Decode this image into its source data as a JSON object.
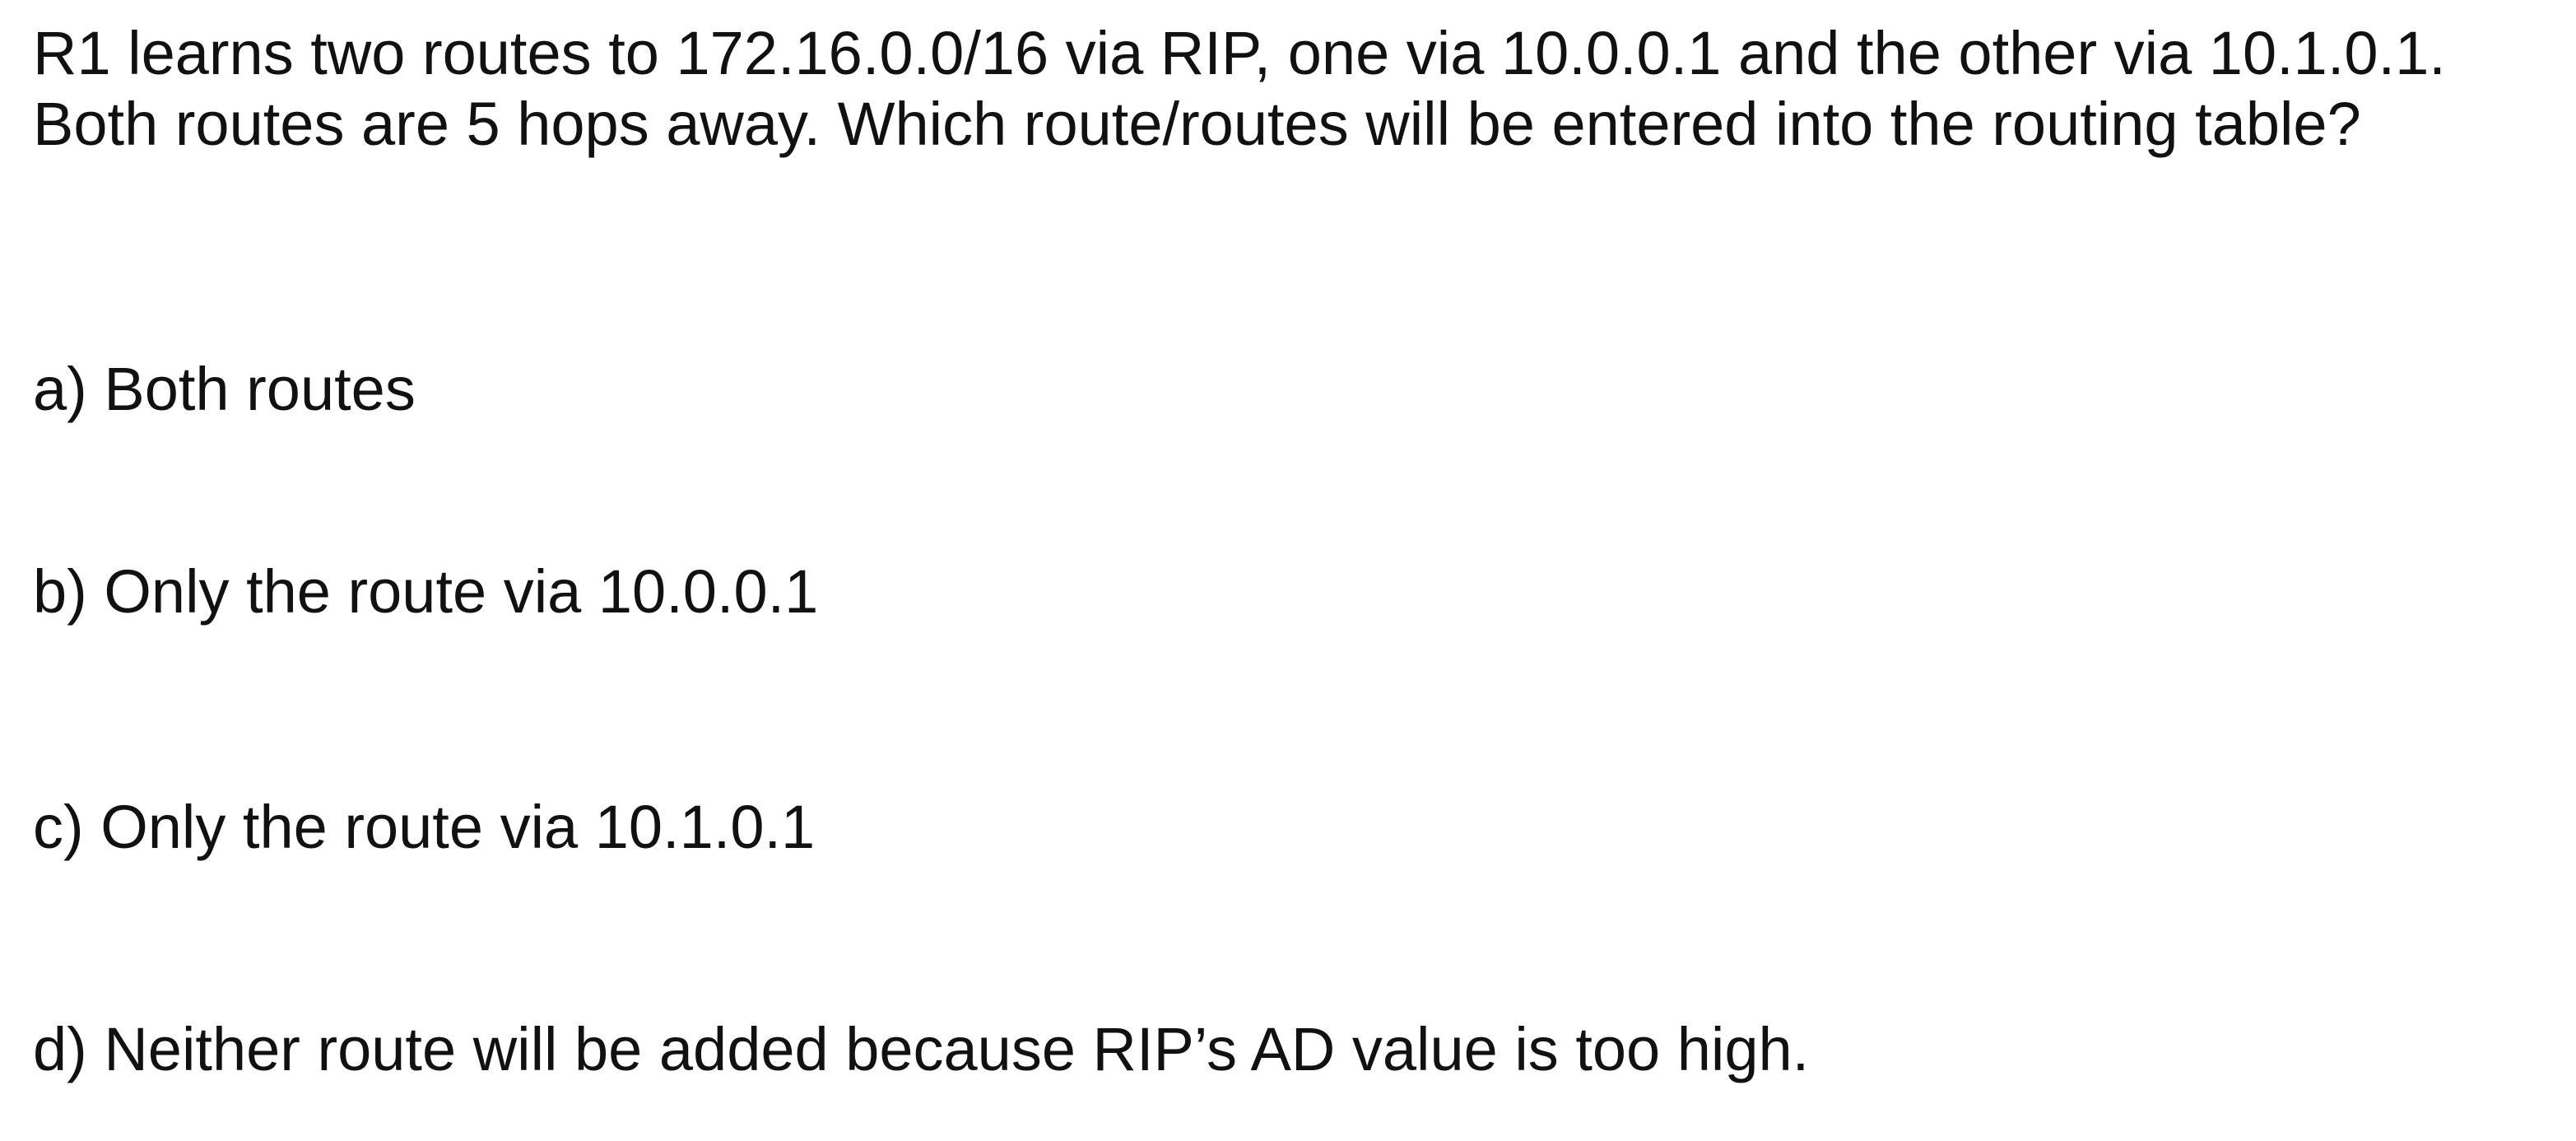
{
  "question": {
    "line1": "R1 learns two routes to 172.16.0.0/16 via RIP, one via 10.0.0.1 and the other via 10.1.0.1.",
    "line2": "Both routes are 5 hops away.  Which route/routes will be entered into the routing table?"
  },
  "options": [
    {
      "text": "a) Both routes"
    },
    {
      "text": "b) Only the route via 10.0.0.1"
    },
    {
      "text": "c) Only the route via 10.1.0.1"
    },
    {
      "text": "d) Neither route will be added because RIP’s AD value is too high."
    }
  ],
  "colors": {
    "background": "#ffffff",
    "text": "#111111"
  }
}
